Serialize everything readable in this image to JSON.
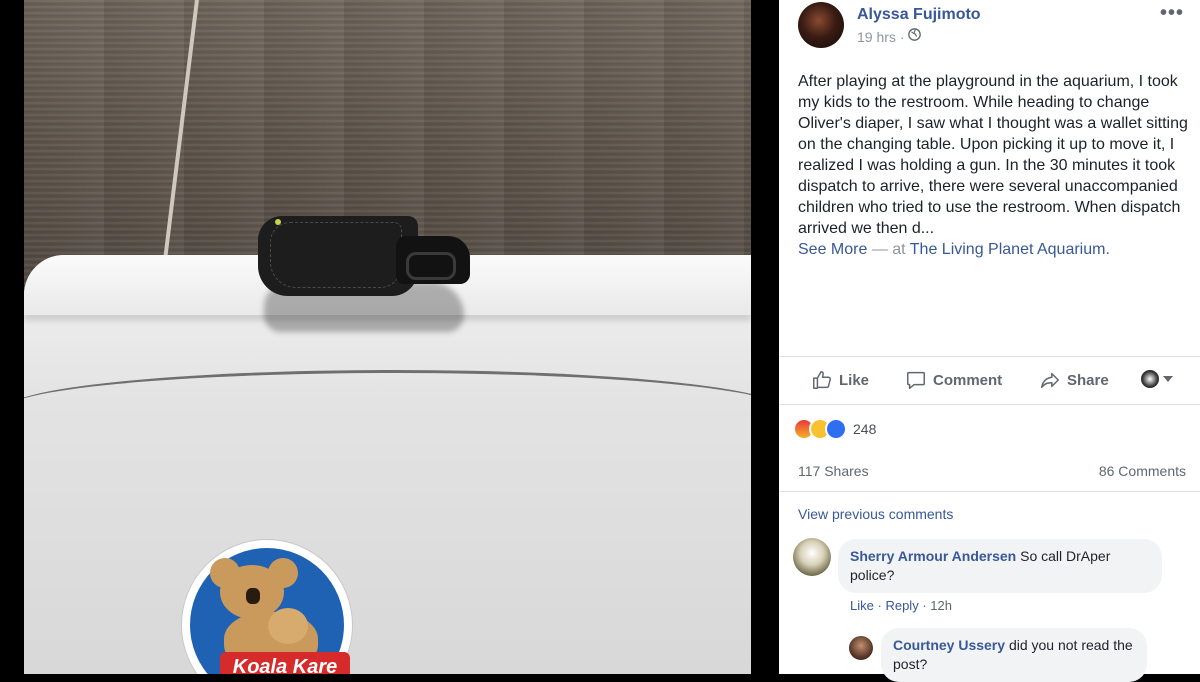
{
  "post": {
    "author": "Alyssa Fujimoto",
    "time": "19 hrs",
    "time_separator": "·",
    "text": "After playing at the playground in the aquarium, I took my kids to the restroom. While heading to change Oliver's diaper, I saw what I thought was a wallet sitting on the changing table. Upon picking it up to move it, I realized I was holding a gun. In the 30 minutes it took dispatch to arrive, there were several unaccompanied children who tried to use the restroom. When dispatch arrived we then d...",
    "see_more": "See More",
    "location_prefix": "— at",
    "location": "The Living Planet Aquarium.",
    "more_label": "•••",
    "privacy_icon": "globe-icon"
  },
  "photo": {
    "sticker_brand": "Koala Kare"
  },
  "actions": {
    "like": "Like",
    "comment": "Comment",
    "share": "Share"
  },
  "stats": {
    "reaction_count": "248",
    "reactions": [
      "angry",
      "wow",
      "like"
    ],
    "shares": "117 Shares",
    "comments": "86 Comments"
  },
  "comments": {
    "view_previous": "View previous comments",
    "items": [
      {
        "name": "Sherry Armour Andersen",
        "text": "So call DrAper police?",
        "like": "Like",
        "reply": "Reply",
        "sep": "·",
        "time": "12h"
      },
      {
        "name": "Courtney Ussery",
        "text": "did you not read the post?"
      }
    ]
  },
  "colors": {
    "link": "#385898",
    "meta": "#90949c",
    "bubble": "#f2f3f5"
  }
}
